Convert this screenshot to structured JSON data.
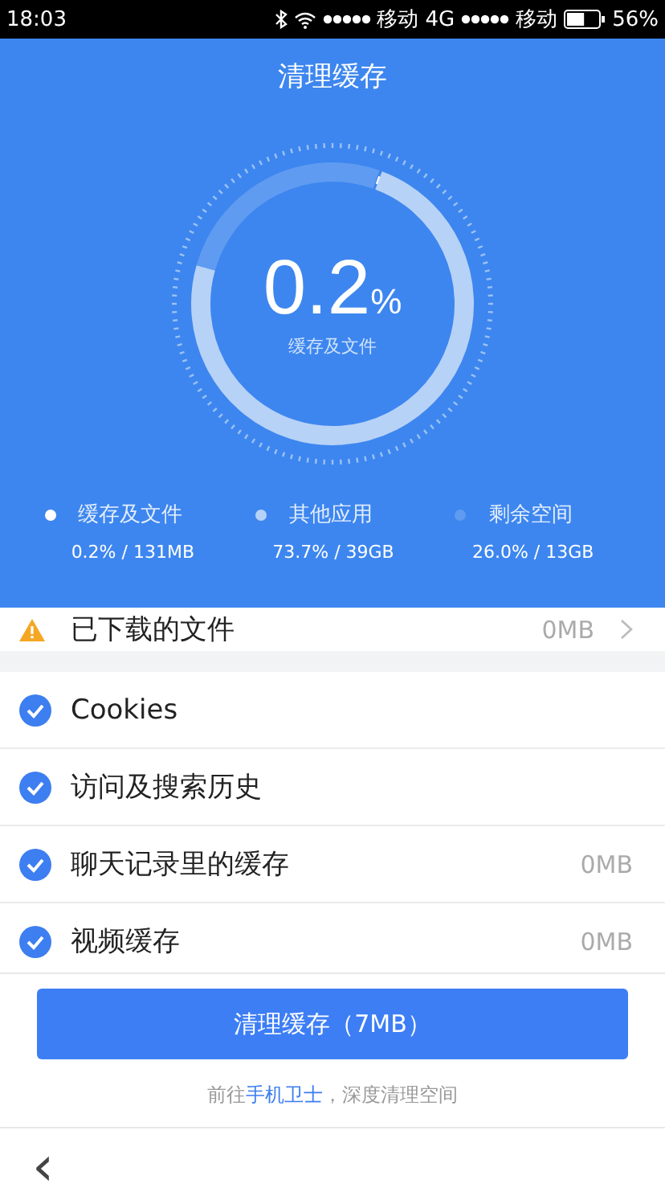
{
  "status_bar": {
    "time": "18:03",
    "carrier_1": "移动",
    "network": "4G",
    "carrier_2": "移动",
    "battery": "56%"
  },
  "header": {
    "title": "清理缓存",
    "percent": "0.2",
    "percent_unit": "%",
    "caption": "缓存及文件"
  },
  "legend": [
    {
      "label": "缓存及文件",
      "value": "0.2% / 131MB",
      "color": "#ffffff"
    },
    {
      "label": "其他应用",
      "value": "73.7% / 39GB",
      "color": "#b7d2f7"
    },
    {
      "label": "剩余空间",
      "value": "26.0% / 13GB",
      "color": "#5f9bf0"
    }
  ],
  "items": [
    {
      "kind": "warning",
      "label": "已下载的文件",
      "value": "0MB"
    },
    {
      "kind": "check",
      "label": "Cookies",
      "checked": true
    },
    {
      "kind": "check",
      "label": "访问及搜索历史",
      "checked": true
    },
    {
      "kind": "check",
      "label": "聊天记录里的缓存",
      "value": "0MB",
      "checked": true
    },
    {
      "kind": "check",
      "label": "视频缓存",
      "value": "0MB",
      "checked": true
    }
  ],
  "clean_button": "清理缓存（7MB）",
  "hint": {
    "before": "前往",
    "link": "手机卫士",
    "after": "，深度清理空间"
  },
  "back": "‹"
}
